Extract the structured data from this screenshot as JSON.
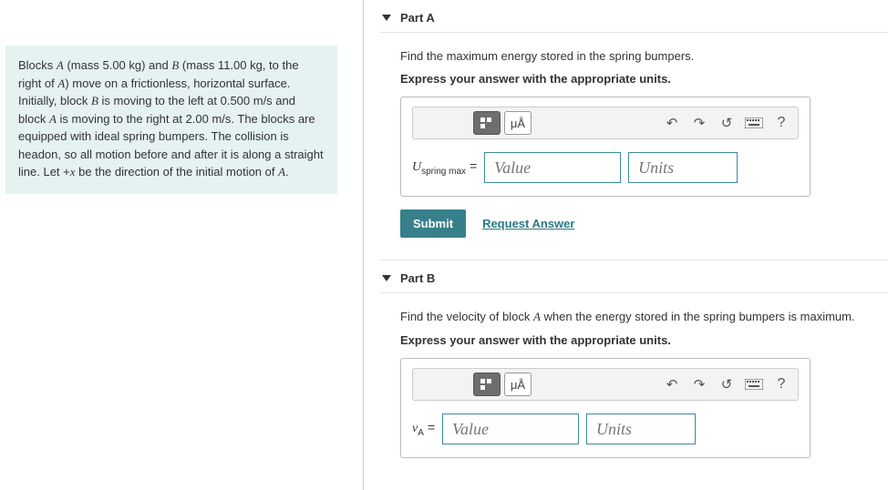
{
  "problem": {
    "html": "Blocks <span class='italic-serif'>A</span> (mass 5.00 kg) and <span class='italic-serif'>B</span> (mass 11.00 kg, to the right of <span class='italic-serif'>A</span>) move on a frictionless, horizontal surface. Initially, block <span class='italic-serif'>B</span> is moving to the left at 0.500 m/s and block <span class='italic-serif'>A</span> is moving to the right at 2.00 m/s. The blocks are equipped with ideal spring bumpers. The collision is headon, so all motion before and after it is along a straight line. Let +<span class='italic-serif'>x</span> be the direction of the initial motion of <span class='italic-serif'>A</span>."
  },
  "partA": {
    "title": "Part A",
    "prompt": "Find the maximum energy stored in the spring bumpers.",
    "instruct": "Express your answer with the appropriate units.",
    "var_html": "<span class='italic-serif'>U</span><span class='sub'>spring max</span> =",
    "value_ph": "Value",
    "units_ph": "Units",
    "submit": "Submit",
    "request": "Request Answer",
    "mu_label": "μÅ",
    "help": "?"
  },
  "partB": {
    "title": "Part B",
    "prompt_html": "Find the velocity of block <span class='italic-serif'>A</span> when the energy stored in the spring bumpers is maximum.",
    "instruct": "Express your answer with the appropriate units.",
    "var_html": "<span class='italic-serif'>v</span><span class='sub'>A</span> =",
    "value_ph": "Value",
    "units_ph": "Units",
    "mu_label": "μÅ",
    "help": "?"
  }
}
